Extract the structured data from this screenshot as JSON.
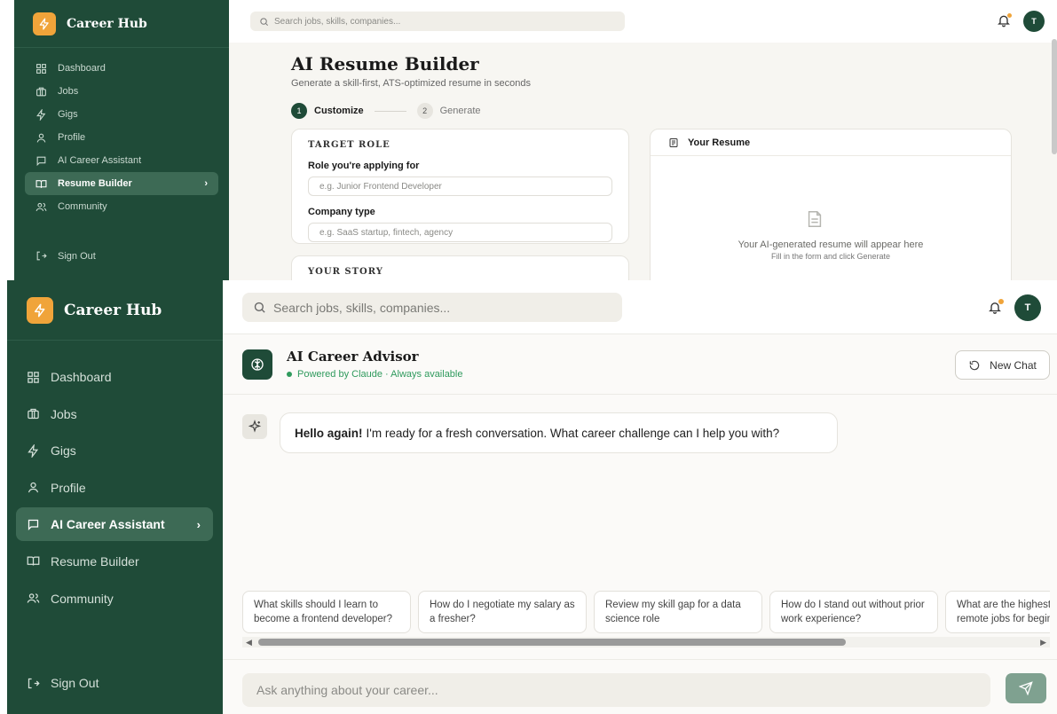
{
  "top": {
    "brand": "Career Hub",
    "nav": [
      {
        "label": "Dashboard"
      },
      {
        "label": "Jobs"
      },
      {
        "label": "Gigs"
      },
      {
        "label": "Profile"
      },
      {
        "label": "AI Career Assistant"
      },
      {
        "label": "Resume Builder",
        "active": true
      },
      {
        "label": "Community"
      }
    ],
    "sign_out": "Sign Out",
    "search_placeholder": "Search jobs, skills, companies...",
    "avatar_initial": "T",
    "title": "AI Resume Builder",
    "subtitle": "Generate a skill-first, ATS-optimized resume in seconds",
    "steps": [
      {
        "num": "1",
        "label": "Customize",
        "active": true
      },
      {
        "num": "2",
        "label": "Generate",
        "active": false
      }
    ],
    "form": {
      "section_target": "TARGET ROLE",
      "role_label": "Role you're applying for",
      "role_placeholder": "e.g. Junior Frontend Developer",
      "company_label": "Company type",
      "company_placeholder": "e.g. SaaS startup, fintech, agency",
      "section_story": "YOUR STORY"
    },
    "resume": {
      "heading": "Your Resume",
      "empty_title": "Your AI-generated resume will appear here",
      "empty_hint": "Fill in the form and click Generate"
    }
  },
  "bottom": {
    "brand": "Career Hub",
    "nav": [
      {
        "label": "Dashboard"
      },
      {
        "label": "Jobs"
      },
      {
        "label": "Gigs"
      },
      {
        "label": "Profile"
      },
      {
        "label": "AI Career Assistant",
        "active": true
      },
      {
        "label": "Resume Builder"
      },
      {
        "label": "Community"
      }
    ],
    "sign_out": "Sign Out",
    "search_placeholder": "Search jobs, skills, companies...",
    "avatar_initial": "T",
    "advisor": {
      "title": "AI Career Advisor",
      "subtitle": "Powered by Claude · Always available",
      "new_chat": "New Chat"
    },
    "message": {
      "bold": "Hello again!",
      "text": "I'm ready for a fresh conversation. What career challenge can I help you with?"
    },
    "suggestions": [
      "What skills should I learn to become a frontend developer?",
      "How do I negotiate my salary as a fresher?",
      "Review my skill gap for a data science role",
      "How do I stand out without prior work experience?",
      "What are the highest paying remote jobs for beginners?"
    ],
    "chat_input_placeholder": "Ask anything about your career...",
    "accent_color": "#1f4b38",
    "brand_logo_color": "#f0a43a"
  }
}
